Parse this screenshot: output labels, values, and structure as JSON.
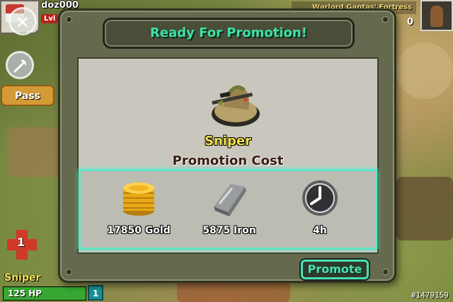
{
  "player": {
    "name": "doz000",
    "level_label": "Lvl"
  },
  "fortress": {
    "name": "Warlord Gantas' Fortress",
    "count_fragment": "0"
  },
  "left_panel": {
    "pass_label": "Pass",
    "medkit_count": "1"
  },
  "unit_status": {
    "name": "Sniper",
    "hp": "125 HP",
    "hp_fraction": 1.0,
    "rank": "1"
  },
  "modal": {
    "title": "Ready For Promotion!",
    "unit_name": "Sniper",
    "cost_heading": "Promotion Cost",
    "costs": [
      {
        "icon": "gold-coins-icon",
        "label": "17850 Gold"
      },
      {
        "icon": "iron-ingot-icon",
        "label": "5875 Iron"
      },
      {
        "icon": "clock-icon",
        "label": "4h"
      }
    ],
    "promote_label": "Promote"
  },
  "watermark": "#1479159",
  "colors": {
    "title_accent": "#3fe0a3",
    "unit_name": "#f3e347",
    "panel_glow": "#5fe6c9",
    "hp_green": "#36a832"
  }
}
